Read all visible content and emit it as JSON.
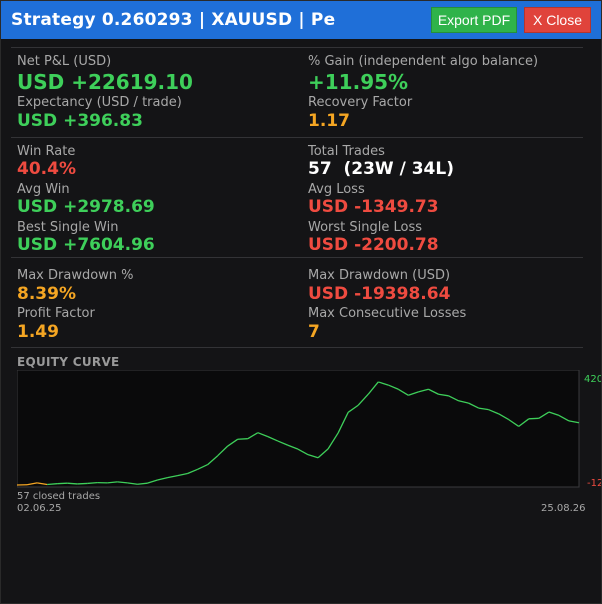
{
  "window": {
    "title": "Strategy 0.260293   |   XAUUSD   |   Pe",
    "buttons": {
      "export_pdf": "Export PDF",
      "close": "X Close"
    }
  },
  "stats": {
    "net_pnl": {
      "label": "Net P&L (USD)",
      "value": "USD +22619.10"
    },
    "gain": {
      "label": "% Gain (independent algo balance)",
      "value": "+11.95%"
    },
    "expectancy": {
      "label": "Expectancy (USD / trade)",
      "value": "USD +396.83"
    },
    "recovery": {
      "label": "Recovery Factor",
      "value": "1.17"
    },
    "win_rate": {
      "label": "Win Rate",
      "value": "40.4%"
    },
    "total_trades": {
      "label": "Total Trades",
      "value": "57  (23W / 34L)"
    },
    "avg_win": {
      "label": "Avg Win",
      "value": "USD +2978.69"
    },
    "avg_loss": {
      "label": "Avg Loss",
      "value": "USD -1349.73"
    },
    "best_win": {
      "label": "Best Single Win",
      "value": "USD +7604.96"
    },
    "worst_loss": {
      "label": "Worst Single Loss",
      "value": "USD -2200.78"
    },
    "max_dd_pct": {
      "label": "Max Drawdown %",
      "value": "8.39%"
    },
    "max_dd_usd": {
      "label": "Max Drawdown (USD)",
      "value": "USD -19398.64"
    },
    "profit_factor": {
      "label": "Profit Factor",
      "value": "1.49"
    },
    "max_consec_losses": {
      "label": "Max Consecutive Losses",
      "value": "7"
    }
  },
  "equity": {
    "title": "EQUITY CURVE",
    "closed_trades": "57 closed trades",
    "start_date": "02.06.25",
    "end_date": "25.08.26",
    "y_max_label": "420",
    "y_min_label": "-12"
  },
  "colors": {
    "titlebar": "#1f6fd8",
    "positive": "#3ecf5a",
    "negative": "#ef4b40",
    "warning": "#f5a623",
    "curve": "#3ecf5a",
    "curve_start": "#f5a623"
  },
  "chart_data": {
    "type": "line",
    "title": "EQUITY CURVE",
    "x": [
      1,
      2,
      3,
      4,
      5,
      6,
      7,
      8,
      9,
      10,
      11,
      12,
      13,
      14,
      15,
      16,
      17,
      18,
      19,
      20,
      21,
      22,
      23,
      24,
      25,
      26,
      27,
      28,
      29,
      30,
      31,
      32,
      33,
      34,
      35,
      36,
      37,
      38,
      39,
      40,
      41,
      42,
      43,
      44,
      45,
      46,
      47,
      48,
      49,
      50,
      51,
      52,
      53,
      54,
      55,
      56,
      57
    ],
    "series": [
      {
        "values": [
          -1200,
          -1100,
          -400,
          -1000,
          -700,
          -500,
          -800,
          -600,
          -300,
          -400,
          0,
          -400,
          -900,
          -500,
          700,
          1600,
          2400,
          3200,
          4800,
          6600,
          10000,
          13700,
          16300,
          16500,
          18800,
          17300,
          15600,
          14000,
          12500,
          10400,
          9200,
          12600,
          18700,
          26600,
          29300,
          33500,
          38200,
          37000,
          35400,
          33100,
          34400,
          35400,
          33500,
          32900,
          31000,
          30100,
          28200,
          27600,
          26000,
          23800,
          21200,
          24100,
          24300,
          26700,
          25400,
          23300,
          22600
        ]
      }
    ],
    "xlabel": "",
    "ylabel": "",
    "ylim": [
      -1200,
      42000
    ],
    "y_tick_labels": [
      "420",
      "-12"
    ],
    "x_tick_labels": [
      "02.06.25",
      "25.08.26"
    ],
    "grid": false,
    "legend": "none"
  }
}
